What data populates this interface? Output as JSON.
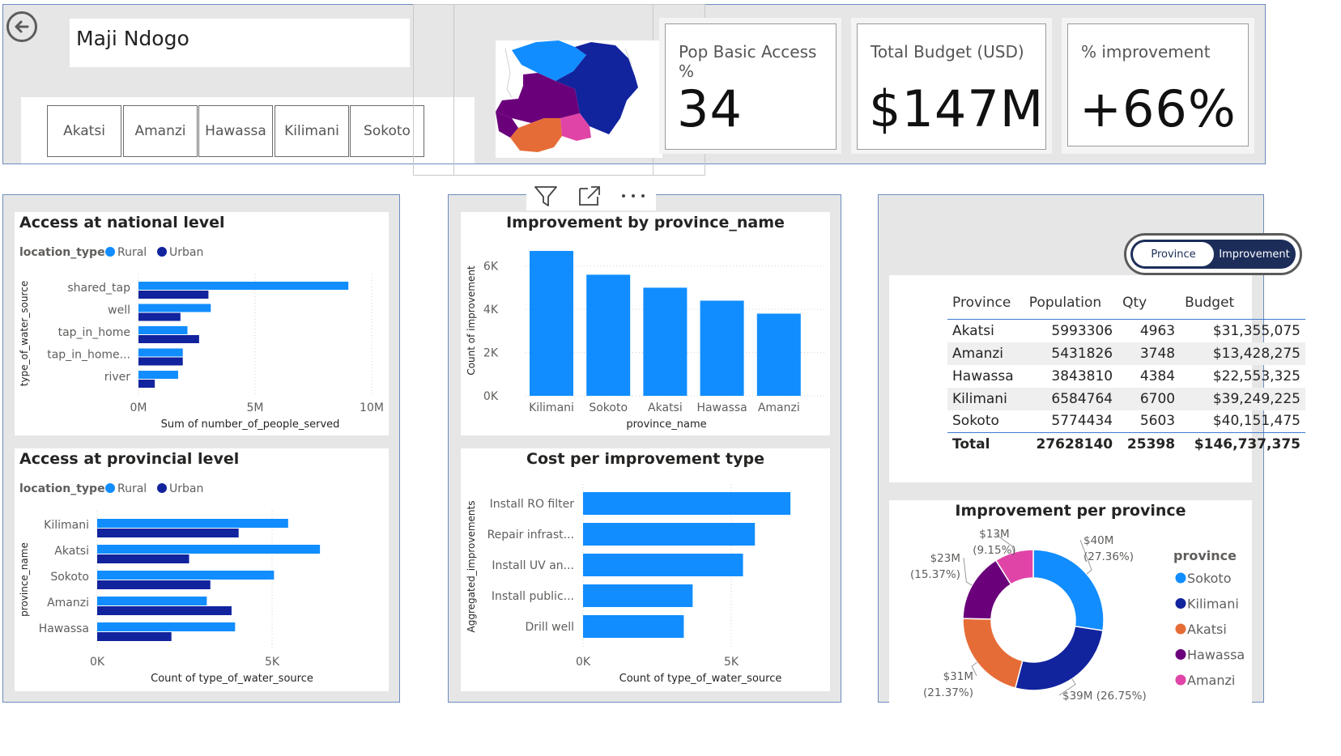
{
  "header": {
    "title": "Maji Ndogo",
    "provinces": [
      "Akatsi",
      "Amanzi",
      "Hawassa",
      "Kilimani",
      "Sokoto"
    ]
  },
  "kpis": [
    {
      "label": "Pop Basic Access %",
      "value": "34"
    },
    {
      "label": "Total Budget (USD)",
      "value": "$147M"
    },
    {
      "label": "% improvement",
      "value": "+66%"
    }
  ],
  "colors": {
    "rural": "#118DFF",
    "urban": "#12239E",
    "sokoto": "#118DFF",
    "kilimani": "#12239E",
    "akatsi": "#E66C37",
    "hawassa": "#6B007B",
    "amanzi": "#E044A7"
  },
  "visual_header_icons": [
    "filter-icon",
    "focus-mode-icon",
    "more-options-icon"
  ],
  "toggle": {
    "left": "Province",
    "right": "Improvement"
  },
  "table": {
    "headers": [
      "Province",
      "Population",
      "Qty",
      "Budget"
    ],
    "rows": [
      [
        "Akatsi",
        "5993306",
        "4963",
        "$31,355,075"
      ],
      [
        "Amanzi",
        "5431826",
        "3748",
        "$13,428,275"
      ],
      [
        "Hawassa",
        "3843810",
        "4384",
        "$22,553,325"
      ],
      [
        "Kilimani",
        "6584764",
        "6700",
        "$39,249,225"
      ],
      [
        "Sokoto",
        "5774434",
        "5603",
        "$40,151,475"
      ]
    ],
    "total": [
      "Total",
      "27628140",
      "25398",
      "$146,737,375"
    ]
  },
  "chart_data": [
    {
      "id": "national",
      "type": "bar",
      "orientation": "horizontal",
      "title": "Access at national level",
      "legend_title": "location_type",
      "categories": [
        "shared_tap",
        "well",
        "tap_in_home",
        "tap_in_home...",
        "river"
      ],
      "series": [
        {
          "name": "Rural",
          "values": [
            9000000,
            3100000,
            2100000,
            1900000,
            1700000
          ]
        },
        {
          "name": "Urban",
          "values": [
            3000000,
            1800000,
            2600000,
            1900000,
            700000
          ]
        }
      ],
      "xlabel": "Sum of number_of_people_served",
      "ylabel": "type_of_water_source",
      "xticks": [
        "0M",
        "5M",
        "10M"
      ],
      "xlim": [
        0,
        10000000
      ]
    },
    {
      "id": "provincial",
      "type": "bar",
      "orientation": "horizontal",
      "title": "Access at provincial level",
      "legend_title": "location_type",
      "categories": [
        "Kilimani",
        "Akatsi",
        "Sokoto",
        "Amanzi",
        "Hawassa"
      ],
      "series": [
        {
          "name": "Rural",
          "values": [
            5400,
            6300,
            5000,
            3100,
            3900
          ]
        },
        {
          "name": "Urban",
          "values": [
            4000,
            2600,
            3200,
            3800,
            2100
          ]
        }
      ],
      "xlabel": "Count of type_of_water_source",
      "ylabel": "province_name",
      "xticks": [
        "0K",
        "5K"
      ],
      "xlim": [
        0,
        7900
      ]
    },
    {
      "id": "improvement",
      "type": "bar",
      "orientation": "vertical",
      "title": "Improvement by province_name",
      "categories": [
        "Kilimani",
        "Sokoto",
        "Akatsi",
        "Hawassa",
        "Amanzi"
      ],
      "values": [
        6700,
        5600,
        5000,
        4400,
        3800
      ],
      "xlabel": "province_name",
      "ylabel": "Count of improvement",
      "yticks": [
        "0K",
        "2K",
        "4K",
        "6K"
      ],
      "ylim": [
        0,
        7000
      ]
    },
    {
      "id": "cost",
      "type": "bar",
      "orientation": "horizontal",
      "title": "Cost per improvement type",
      "categories": [
        "Install RO filter",
        "Repair infrast...",
        "Install UV an...",
        "Install public...",
        "Drill well"
      ],
      "values": [
        7000,
        5800,
        5400,
        3700,
        3400
      ],
      "xlabel": "Count of type_of_water_source",
      "ylabel": "Aggregated_improvements",
      "xticks": [
        "0K",
        "5K"
      ],
      "xlim": [
        0,
        8200
      ]
    },
    {
      "id": "donut",
      "type": "pie",
      "title": "Improvement per province",
      "legend_title": "province",
      "slices": [
        {
          "name": "Sokoto",
          "value": 40,
          "label": "$40M",
          "pct": "(27.36%)"
        },
        {
          "name": "Kilimani",
          "value": 39,
          "label": "$39M (26.75%)",
          "pct": ""
        },
        {
          "name": "Akatsi",
          "value": 31,
          "label": "$31M",
          "pct": "(21.37%)"
        },
        {
          "name": "Hawassa",
          "value": 23,
          "label": "$23M",
          "pct": "(15.37%)"
        },
        {
          "name": "Amanzi",
          "value": 13,
          "label": "$13M",
          "pct": "(9.15%)"
        }
      ]
    }
  ]
}
